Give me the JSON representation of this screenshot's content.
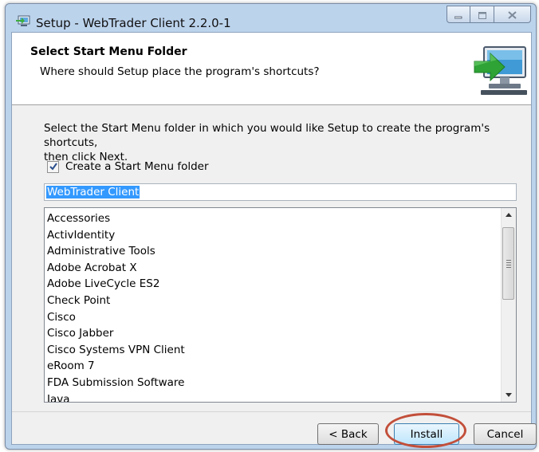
{
  "window": {
    "title": "Setup - WebTrader Client 2.2.0-1"
  },
  "header": {
    "title": "Select Start Menu Folder",
    "subtitle": "Where should Setup place the program's shortcuts?"
  },
  "body": {
    "instruction_line1": "Select the Start Menu folder in which you would like Setup to create the program's shortcuts,",
    "instruction_line2": "then click Next.",
    "create_folder_label": "Create a Start Menu folder",
    "create_folder_checked": true,
    "folder_name_value": "WebTrader Client",
    "folder_list": [
      "Accessories",
      "ActivIdentity",
      "Administrative Tools",
      "Adobe Acrobat X",
      "Adobe LiveCycle ES2",
      "Check Point",
      "Cisco",
      "Cisco Jabber",
      "Cisco Systems VPN Client",
      "eRoom 7",
      "FDA Submission Software",
      "Java"
    ]
  },
  "footer": {
    "back_label": "< Back",
    "install_label": "Install",
    "cancel_label": "Cancel"
  },
  "colors": {
    "highlight_circle": "#c24f3a",
    "selection": "#3399ff"
  },
  "icons": [
    "setup-app-icon",
    "minimize-icon",
    "maximize-icon",
    "close-icon",
    "computer-arrow-icon",
    "checkmark-icon",
    "scroll-up-icon",
    "scroll-down-icon"
  ]
}
